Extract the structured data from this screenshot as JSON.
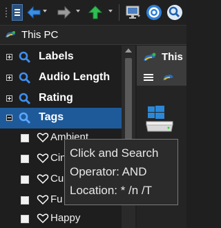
{
  "toolbar": {
    "menu_icon": "hamburger-menu-icon",
    "back_icon": "arrow-left-icon",
    "forward_icon": "arrow-right-icon",
    "up_icon": "arrow-up-icon",
    "display_icon": "monitor-icon",
    "radio_icon": "target-icon",
    "search_icon": "magnifier-icon",
    "colors": {
      "accent": "#2e7ad6",
      "up_arrow": "#27b34a"
    }
  },
  "address": {
    "location": "This PC",
    "icon": "this-pc-icon"
  },
  "tree": {
    "items": [
      {
        "label": "Labels",
        "expanded": false
      },
      {
        "label": "Audio Length",
        "expanded": false
      },
      {
        "label": "Rating",
        "expanded": false
      },
      {
        "label": "Tags",
        "expanded": true,
        "selected": true
      }
    ],
    "tags": [
      {
        "label": "Ambient",
        "checked": false
      },
      {
        "label": "Cin",
        "checked": false
      },
      {
        "label": "Cu",
        "checked": false
      },
      {
        "label": "Fu",
        "checked": false
      },
      {
        "label": "Happy",
        "checked": false
      }
    ],
    "selected_color": "#1e5a99"
  },
  "right_pane": {
    "title": "This"
  },
  "tooltip": {
    "line1": "Click and Search",
    "line2": "Operator: AND",
    "line3": "Location: * /n /T"
  }
}
